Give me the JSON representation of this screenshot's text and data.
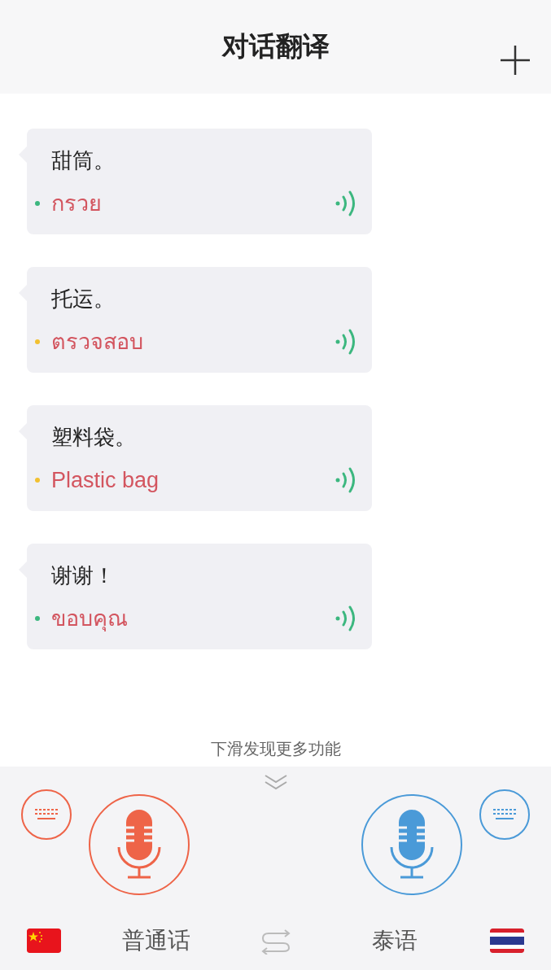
{
  "header": {
    "title": "对话翻译"
  },
  "messages": [
    {
      "source": "甜筒。",
      "translation": "กรวย",
      "color": "#3cb77f"
    },
    {
      "source": "托运。",
      "translation": "ตรวจสอบ",
      "color": "#f2c030"
    },
    {
      "source": "塑料袋。",
      "translation": "Plastic bag",
      "color": "#f2c030"
    },
    {
      "source": "谢谢！",
      "translation": "ขอบคุณ",
      "color": "#3cb77f"
    }
  ],
  "hint": "下滑发现更多功能",
  "languages": [
    {
      "label": "普通话",
      "kind": "cn",
      "color": "#ee6448"
    },
    {
      "label": "泰语",
      "kind": "th",
      "color": "#4a9ad8"
    }
  ]
}
